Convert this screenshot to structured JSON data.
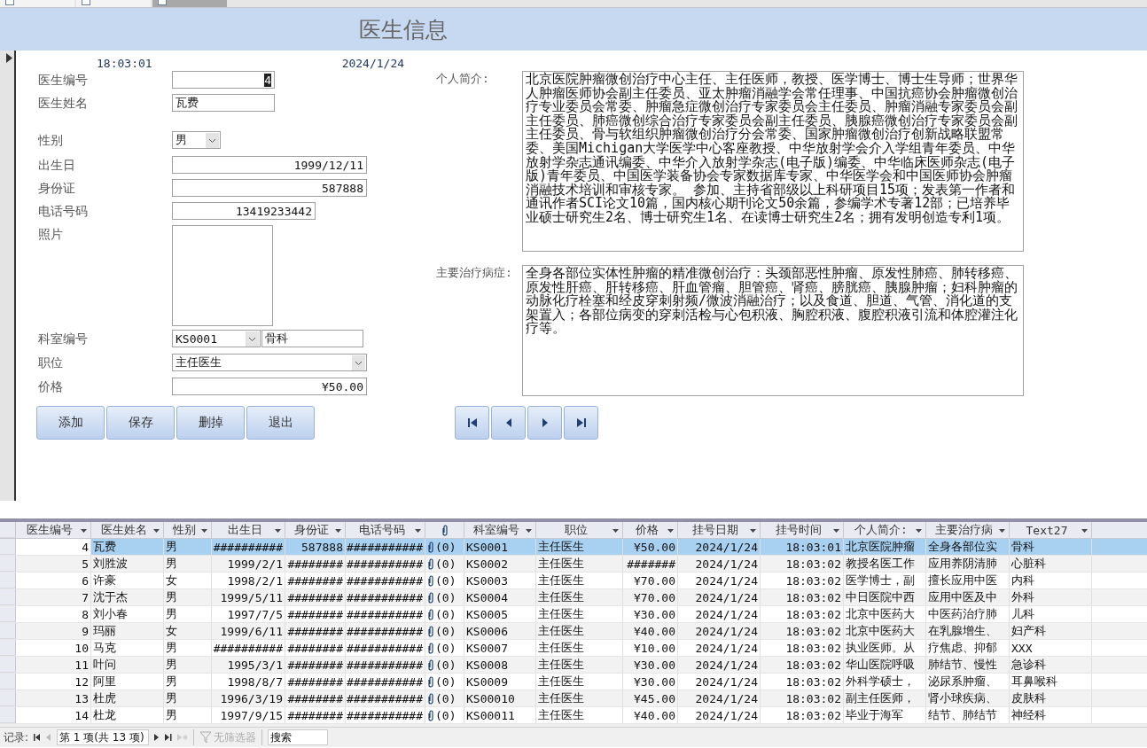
{
  "tabs": [
    {
      "selected": false
    },
    {
      "selected": false
    },
    {
      "selected": true
    }
  ],
  "form": {
    "title": "医生信息",
    "time": "18:03:01",
    "date": "2024/1/24",
    "fields": [
      {
        "label": "医生编号",
        "kind": "text",
        "value": "4",
        "text_selected": true
      },
      {
        "label": "医生姓名",
        "kind": "text",
        "value": "瓦费",
        "text_selected": false
      },
      {
        "label": "性别",
        "kind": "combo",
        "value": "男",
        "text_selected": false
      },
      {
        "label": "出生日",
        "kind": "text",
        "value": "1999/12/11",
        "text_selected": false
      },
      {
        "label": "身份证",
        "kind": "text",
        "value": "587888",
        "text_selected": false
      },
      {
        "label": "电话号码",
        "kind": "text",
        "value": "13419233442",
        "text_selected": false
      },
      {
        "label": "照片",
        "kind": "photo"
      },
      {
        "label": "科室编号",
        "kind": "combo-pair",
        "value": "KS0001",
        "extra": "骨科",
        "text_selected": false
      },
      {
        "label": "职位",
        "kind": "combo",
        "value": "主任医生",
        "text_selected": false
      },
      {
        "label": "价格",
        "kind": "text",
        "value": "¥50.00",
        "text_selected": false
      }
    ],
    "memos": [
      {
        "label": "个人简介:",
        "value": "北京医院肿瘤微创治疗中心主任、主任医师，教授、医学博士、博士生导师；世界华人肿瘤医师协会副主任委员、亚太肿瘤消融学会常任理事、中国抗癌协会肿瘤微创治疗专业委员会常委、肿瘤急症微创治疗专家委员会主任委员、肿瘤消融专家委员会副主任委员、肺癌微创综合治疗专家委员会副主任委员、胰腺癌微创治疗专家委员会副主任委员、骨与软组织肿瘤微创治疗分会常委、国家肿瘤微创治疗创新战略联盟常委、美国Michigan大学医学中心客座教授、中华放射学会介入学组青年委员、中华放射学杂志通讯编委、中华介入放射学杂志(电子版)编委、中华临床医师杂志(电子版)青年委员、中国医学装备协会专家数据库专家、中华医学会和中国医师协会肿瘤消融技术培训和审核专家。 参加、主持省部级以上科研项目15项；发表第一作者和通讯作者SCI论文10篇，国内核心期刊论文50余篇，参编学术专著12部；已培养毕业硕士研究生2名、博士研究生1名、在读博士研究生2名；拥有发明创造专利1项。"
      },
      {
        "label": "主要治疗病症:",
        "value": "全身各部位实体性肿瘤的精准微创治疗：头颈部恶性肿瘤、原发性肺癌、肺转移癌、原发性肝癌、肝转移癌、肝血管瘤、胆管癌、肾癌、膀胱癌、胰腺肿瘤；妇科肿瘤的动脉化疗栓塞和经皮穿刺射频/微波消融治疗；以及食道、胆道、气管、消化道的支架置入；各部位病变的穿刺活检与心包积液、胸腔积液、腹腔积液引流和体腔灌注化疗等。"
      }
    ],
    "buttons": [
      "添加",
      "保存",
      "删掉",
      "退出"
    ]
  },
  "table": {
    "columns": [
      {
        "label": "医生编号",
        "kind": "text"
      },
      {
        "label": "医生姓名",
        "kind": "text"
      },
      {
        "label": "性别",
        "kind": "text"
      },
      {
        "label": "出生日",
        "kind": "text"
      },
      {
        "label": "身份证",
        "kind": "text"
      },
      {
        "label": "电话号码",
        "kind": "text"
      },
      {
        "kind": "attachment"
      },
      {
        "label": "科室编号",
        "kind": "text"
      },
      {
        "label": "职位",
        "kind": "text"
      },
      {
        "label": "价格",
        "kind": "text"
      },
      {
        "label": "挂号日期",
        "kind": "text"
      },
      {
        "label": "挂号时间",
        "kind": "text"
      },
      {
        "label": "个人简介:",
        "kind": "text"
      },
      {
        "label": "主要治疗病",
        "kind": "text"
      },
      {
        "label": "Text27",
        "kind": "text"
      }
    ],
    "rows": [
      {
        "selected": true,
        "cells": [
          "4",
          "瓦费",
          "男",
          "##########",
          "587888",
          "###########",
          "(0)",
          "KS0001",
          "主任医生",
          "¥50.00",
          "2024/1/24",
          "18:03:01",
          "北京医院肿瘤",
          "全身各部位实",
          "骨科"
        ]
      },
      {
        "selected": false,
        "cells": [
          "5",
          "刘胜波",
          "男",
          "1999/2/1",
          "########",
          "###########",
          "(0)",
          "KS0002",
          "主任医生",
          "#######",
          "2024/1/24",
          "18:03:02",
          "教授名医工作",
          "应用养阴清肺",
          "心脏科"
        ]
      },
      {
        "selected": false,
        "cells": [
          "6",
          "许豪",
          "女",
          "1998/2/1",
          "########",
          "###########",
          "(0)",
          "KS0003",
          "主任医生",
          "¥70.00",
          "2024/1/24",
          "18:03:02",
          "医学博士，副",
          "擅长应用中医",
          "内科"
        ]
      },
      {
        "selected": false,
        "cells": [
          "7",
          "沈于杰",
          "男",
          "1999/5/11",
          "########",
          "###########",
          "(0)",
          "KS0004",
          "主任医生",
          "¥70.00",
          "2024/1/24",
          "18:03:02",
          "中日医院中西",
          "应用中医及中",
          "外科"
        ]
      },
      {
        "selected": false,
        "cells": [
          "8",
          "刘小春",
          "男",
          "1997/7/5",
          "########",
          "###########",
          "(0)",
          "KS0005",
          "主任医生",
          "¥30.00",
          "2024/1/24",
          "18:03:02",
          "北京中医药大",
          "中医药治疗肺",
          "儿科"
        ]
      },
      {
        "selected": false,
        "cells": [
          "9",
          "玛丽",
          "女",
          "1999/6/11",
          "########",
          "###########",
          "(0)",
          "KS0006",
          "主任医生",
          "¥40.00",
          "2024/1/24",
          "18:03:02",
          "北京中医药大",
          "在乳腺增生、",
          "妇产科"
        ]
      },
      {
        "selected": false,
        "cells": [
          "10",
          "马克",
          "男",
          "##########",
          "########",
          "###########",
          "(0)",
          "KS0007",
          "主任医生",
          "¥10.00",
          "2024/1/24",
          "18:03:02",
          "执业医师。从",
          "疗焦虑、抑郁",
          "XXX"
        ]
      },
      {
        "selected": false,
        "cells": [
          "11",
          "叶问",
          "男",
          "1995/3/1",
          "########",
          "###########",
          "(0)",
          "KS0008",
          "主任医生",
          "¥30.00",
          "2024/1/24",
          "18:03:02",
          "华山医院呼吸",
          "肺结节、慢性",
          "急诊科"
        ]
      },
      {
        "selected": false,
        "cells": [
          "12",
          "阿里",
          "男",
          "1998/8/7",
          "########",
          "###########",
          "(0)",
          "KS0009",
          "主任医生",
          "¥30.00",
          "2024/1/24",
          "18:03:02",
          "外科学硕士，",
          "泌尿系肿瘤、",
          "耳鼻喉科"
        ]
      },
      {
        "selected": false,
        "cells": [
          "13",
          "杜虎",
          "男",
          "1996/3/19",
          "########",
          "###########",
          "(0)",
          "KS00010",
          "主任医生",
          "¥45.00",
          "2024/1/24",
          "18:03:02",
          "副主任医师，",
          "肾小球疾病、",
          "皮肤科"
        ]
      },
      {
        "selected": false,
        "cells": [
          "14",
          "杜龙",
          "男",
          "1997/9/15",
          "########",
          "###########",
          "(0)",
          "KS00011",
          "主任医生",
          "¥40.00",
          "2024/1/24",
          "18:03:02",
          "毕业于海军",
          "结节、肺结节",
          "神经科"
        ]
      }
    ]
  },
  "status_bar": {
    "label": "记录:",
    "position": "第 1 项(共 13 项)",
    "filter": {
      "label": "无筛选器",
      "disabled": true
    },
    "search": {
      "placeholder": "搜索"
    }
  }
}
